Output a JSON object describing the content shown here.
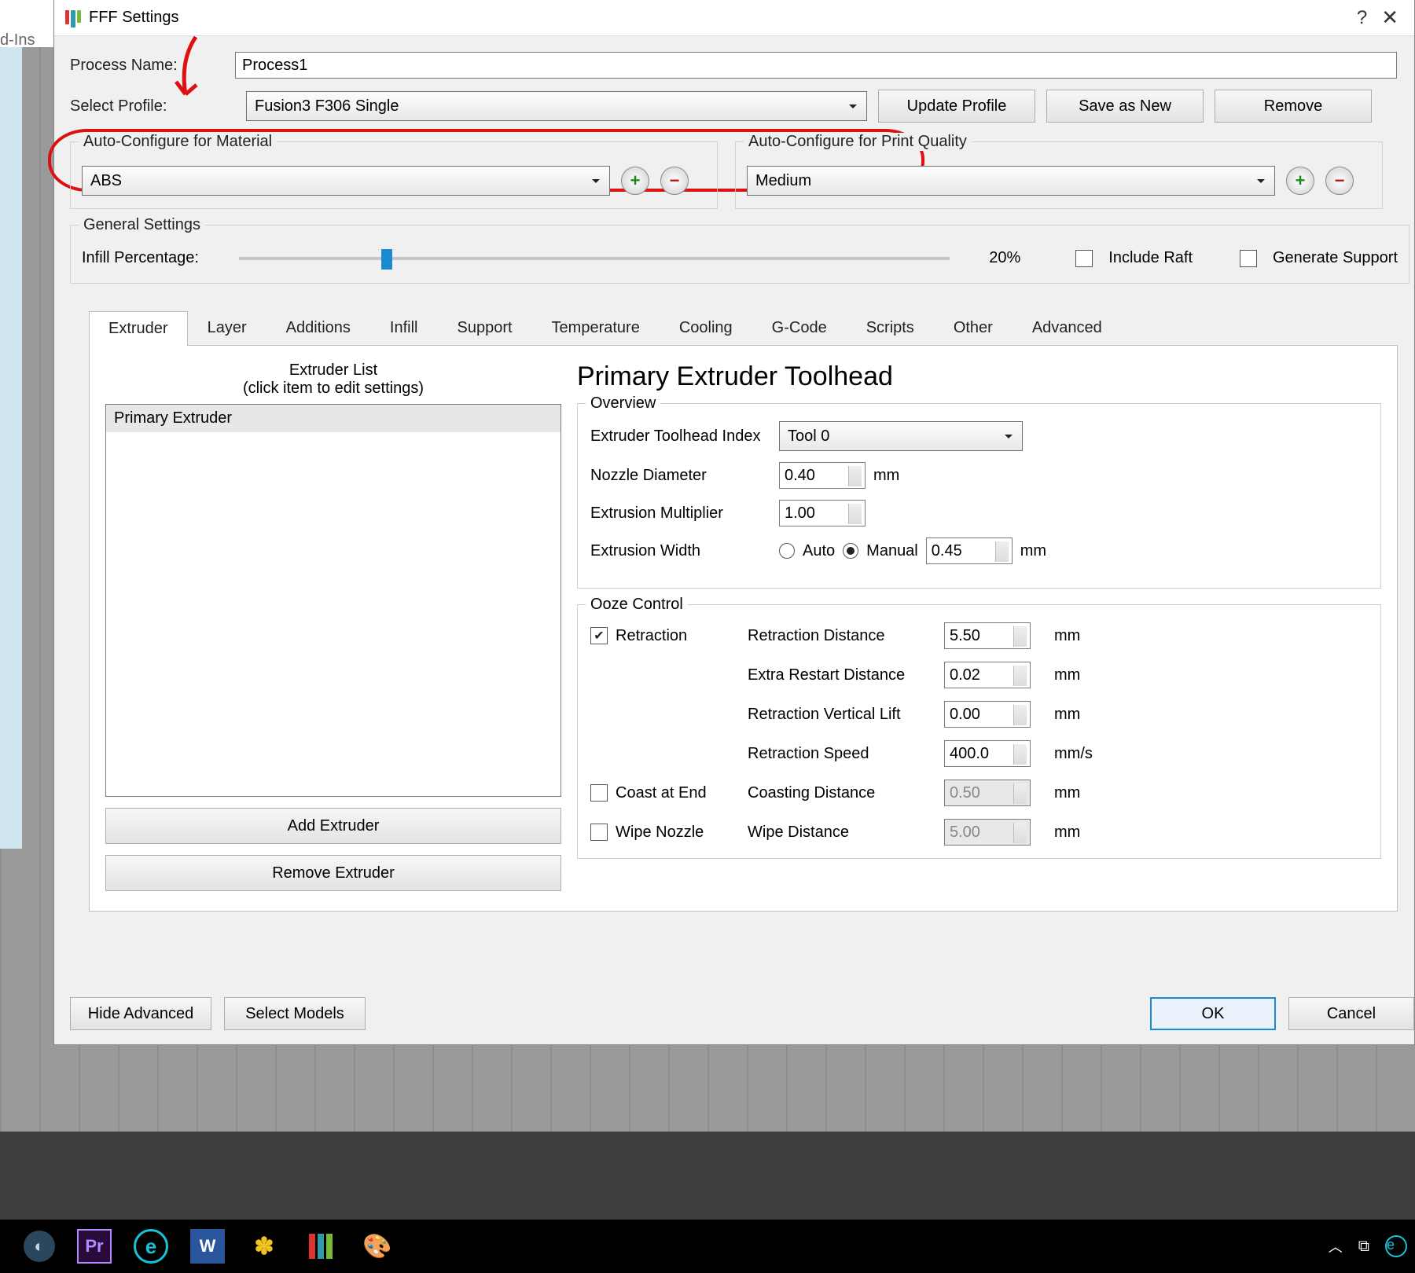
{
  "bg_tab": "d-Ins",
  "window": {
    "title": "FFF Settings",
    "help": "?",
    "close": "✕"
  },
  "process": {
    "label": "Process Name:",
    "value": "Process1"
  },
  "profile": {
    "label": "Select Profile:",
    "value": "Fusion3 F306 Single",
    "update": "Update Profile",
    "save": "Save as New",
    "remove": "Remove"
  },
  "auto_mat": {
    "title": "Auto-Configure for Material",
    "value": "ABS"
  },
  "auto_qual": {
    "title": "Auto-Configure for Print Quality",
    "value": "Medium"
  },
  "general": {
    "title": "General Settings",
    "infill_label": "Infill Percentage:",
    "infill_pct": "20%",
    "raft": "Include Raft",
    "support": "Generate Support"
  },
  "tabs": [
    "Extruder",
    "Layer",
    "Additions",
    "Infill",
    "Support",
    "Temperature",
    "Cooling",
    "G-Code",
    "Scripts",
    "Other",
    "Advanced"
  ],
  "extruder": {
    "list_title": "Extruder List",
    "list_sub": "(click item to edit settings)",
    "items": [
      "Primary Extruder"
    ],
    "add": "Add Extruder",
    "remove": "Remove Extruder",
    "heading": "Primary Extruder Toolhead",
    "overview": {
      "title": "Overview",
      "index_label": "Extruder Toolhead Index",
      "index_value": "Tool 0",
      "nozzle_label": "Nozzle Diameter",
      "nozzle_value": "0.40",
      "nozzle_unit": "mm",
      "mult_label": "Extrusion Multiplier",
      "mult_value": "1.00",
      "width_label": "Extrusion Width",
      "width_auto": "Auto",
      "width_manual": "Manual",
      "width_value": "0.45",
      "width_unit": "mm"
    },
    "ooze": {
      "title": "Ooze Control",
      "retraction": "Retraction",
      "coast": "Coast at End",
      "wipe": "Wipe Nozzle",
      "dist_label": "Retraction Distance",
      "dist_value": "5.50",
      "dist_unit": "mm",
      "extra_label": "Extra Restart Distance",
      "extra_value": "0.02",
      "extra_unit": "mm",
      "lift_label": "Retraction Vertical Lift",
      "lift_value": "0.00",
      "lift_unit": "mm",
      "speed_label": "Retraction Speed",
      "speed_value": "400.0",
      "speed_unit": "mm/s",
      "coast_label": "Coasting Distance",
      "coast_value": "0.50",
      "coast_unit": "mm",
      "wipe_label": "Wipe Distance",
      "wipe_value": "5.00",
      "wipe_unit": "mm"
    }
  },
  "footer": {
    "hide": "Hide Advanced",
    "select": "Select Models",
    "ok": "OK",
    "cancel": "Cancel"
  }
}
